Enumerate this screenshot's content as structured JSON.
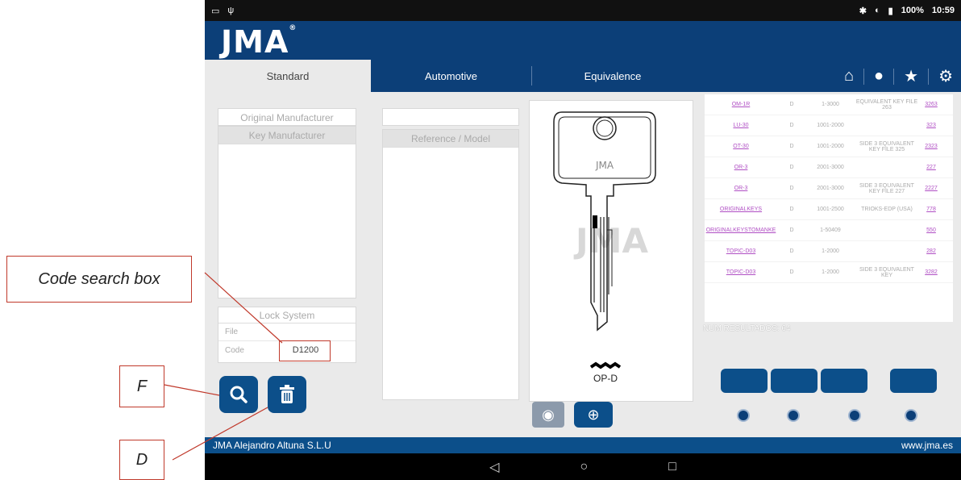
{
  "annotations": {
    "code_search_box": "Code search box",
    "f": "F",
    "d": "D"
  },
  "status_bar": {
    "battery": "100%",
    "time": "10:59"
  },
  "app": {
    "logo": "JMA",
    "registered": "®"
  },
  "tabs": [
    "Standard",
    "Automotive",
    "Equivalence"
  ],
  "left_panel": {
    "original_manufacturer": "Original Manufacturer",
    "key_manufacturer": "Key Manufacturer",
    "lock_system": "Lock System",
    "file_label": "File",
    "code_label": "Code",
    "code_value": "D1200"
  },
  "middle_panel": {
    "reference_model": "Reference / Model"
  },
  "key_preview": {
    "key_label": "OP-D",
    "watermark": "JMA",
    "head_brand": "JMA"
  },
  "results": {
    "rows": [
      {
        "ref": "OM-1R",
        "t": "D",
        "range": "1-3000",
        "note": "EQUIVALENT KEY FILE 263",
        "file": "3263"
      },
      {
        "ref": "LU-30",
        "t": "D",
        "range": "1001-2000",
        "note": "",
        "file": "323"
      },
      {
        "ref": "OT-30",
        "t": "D",
        "range": "1001-2000",
        "note": "SIDE 3 EQUIVALENT KEY FILE 325",
        "file": "2323"
      },
      {
        "ref": "OR-3",
        "t": "D",
        "range": "2001-3000",
        "note": "",
        "file": "227"
      },
      {
        "ref": "OR-3",
        "t": "D",
        "range": "2001-3000",
        "note": "SIDE 3 EQUIVALENT KEY FILE 227",
        "file": "2227"
      },
      {
        "ref": "ORIGINALKEYS",
        "t": "D",
        "range": "1001-2500",
        "note": "TRIOKS-EDP (USA)",
        "file": "778"
      },
      {
        "ref": "ORIGINALKEYSTOMANKE",
        "t": "D",
        "range": "1-50409",
        "note": "",
        "file": "550"
      },
      {
        "ref": "TOPIC-D03",
        "t": "D",
        "range": "1-2000",
        "note": "",
        "file": "282"
      },
      {
        "ref": "TOPIC-D03",
        "t": "D",
        "range": "1-2000",
        "note": "SIDE 3 EQUIVALENT KEY",
        "file": "3282"
      }
    ],
    "count_label": "NUM RESULTADOS: 64"
  },
  "footer": {
    "company": "JMA Alejandro Altuna S.L.U",
    "website": "www.jma.es"
  },
  "colors": {
    "brand_blue": "#0c3f78",
    "button_blue": "#0c4f8a",
    "link_purple": "#b04fc4",
    "callout_red": "#c0392b"
  }
}
